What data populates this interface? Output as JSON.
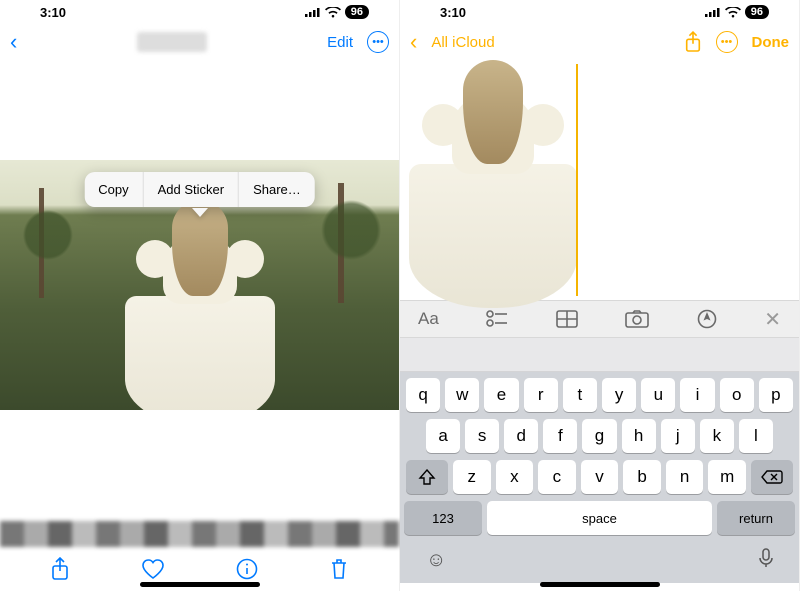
{
  "status": {
    "time": "3:10",
    "battery": "96"
  },
  "photos": {
    "nav": {
      "edit": "Edit"
    },
    "context_menu": {
      "copy": "Copy",
      "add_sticker": "Add Sticker",
      "share": "Share…"
    }
  },
  "notes": {
    "nav": {
      "back": "All iCloud",
      "done": "Done"
    },
    "tools": {
      "text": "Aa"
    }
  },
  "keyboard": {
    "row1": [
      "q",
      "w",
      "e",
      "r",
      "t",
      "y",
      "u",
      "i",
      "o",
      "p"
    ],
    "row2": [
      "a",
      "s",
      "d",
      "f",
      "g",
      "h",
      "j",
      "k",
      "l"
    ],
    "row3": [
      "z",
      "x",
      "c",
      "v",
      "b",
      "n",
      "m"
    ],
    "numbers": "123",
    "space": "space",
    "return": "return"
  }
}
